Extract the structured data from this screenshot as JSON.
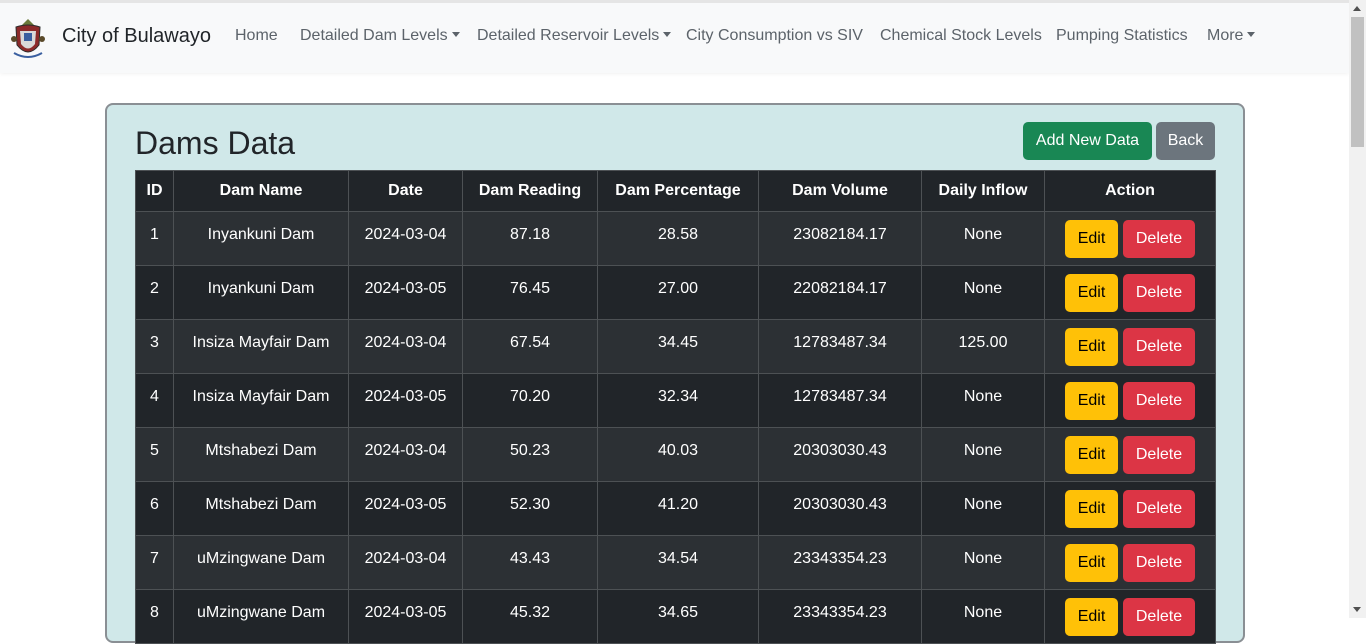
{
  "navbar": {
    "brand": "City of Bulawayo",
    "links": [
      {
        "label": "Home",
        "dropdown": false
      },
      {
        "label": "Detailed Dam Levels",
        "dropdown": true
      },
      {
        "label": "Detailed Reservoir Levels",
        "dropdown": true
      },
      {
        "label": "City Consumption vs SIV",
        "dropdown": false
      },
      {
        "label": "Chemical Stock Levels",
        "dropdown": false
      },
      {
        "label": "Pumping Statistics",
        "dropdown": false
      },
      {
        "label": "More",
        "dropdown": true
      }
    ]
  },
  "page": {
    "title": "Dams Data",
    "add_button": "Add New Data",
    "back_button": "Back"
  },
  "table": {
    "headers": [
      "ID",
      "Dam Name",
      "Date",
      "Dam Reading",
      "Dam Percentage",
      "Dam Volume",
      "Daily Inflow",
      "Action"
    ],
    "edit_label": "Edit",
    "delete_label": "Delete",
    "rows": [
      {
        "id": "1",
        "name": "Inyankuni Dam",
        "date": "2024-03-04",
        "reading": "87.18",
        "percentage": "28.58",
        "volume": "23082184.17",
        "inflow": "None"
      },
      {
        "id": "2",
        "name": "Inyankuni Dam",
        "date": "2024-03-05",
        "reading": "76.45",
        "percentage": "27.00",
        "volume": "22082184.17",
        "inflow": "None"
      },
      {
        "id": "3",
        "name": "Insiza Mayfair Dam",
        "date": "2024-03-04",
        "reading": "67.54",
        "percentage": "34.45",
        "volume": "12783487.34",
        "inflow": "125.00"
      },
      {
        "id": "4",
        "name": "Insiza Mayfair Dam",
        "date": "2024-03-05",
        "reading": "70.20",
        "percentage": "32.34",
        "volume": "12783487.34",
        "inflow": "None"
      },
      {
        "id": "5",
        "name": "Mtshabezi Dam",
        "date": "2024-03-04",
        "reading": "50.23",
        "percentage": "40.03",
        "volume": "20303030.43",
        "inflow": "None"
      },
      {
        "id": "6",
        "name": "Mtshabezi Dam",
        "date": "2024-03-05",
        "reading": "52.30",
        "percentage": "41.20",
        "volume": "20303030.43",
        "inflow": "None"
      },
      {
        "id": "7",
        "name": "uMzingwane Dam",
        "date": "2024-03-04",
        "reading": "43.43",
        "percentage": "34.54",
        "volume": "23343354.23",
        "inflow": "None"
      },
      {
        "id": "8",
        "name": "uMzingwane Dam",
        "date": "2024-03-05",
        "reading": "45.32",
        "percentage": "34.65",
        "volume": "23343354.23",
        "inflow": "None"
      }
    ]
  },
  "colors": {
    "add_button": "#198754",
    "back_button": "#6c757d",
    "edit_button": "#ffc107",
    "delete_button": "#dc3545",
    "card_background": "#d0e8e9",
    "table_dark": "#212529"
  },
  "icons": {
    "logo": "city-coat-of-arms-logo",
    "dropdown": "caret-down-icon"
  }
}
